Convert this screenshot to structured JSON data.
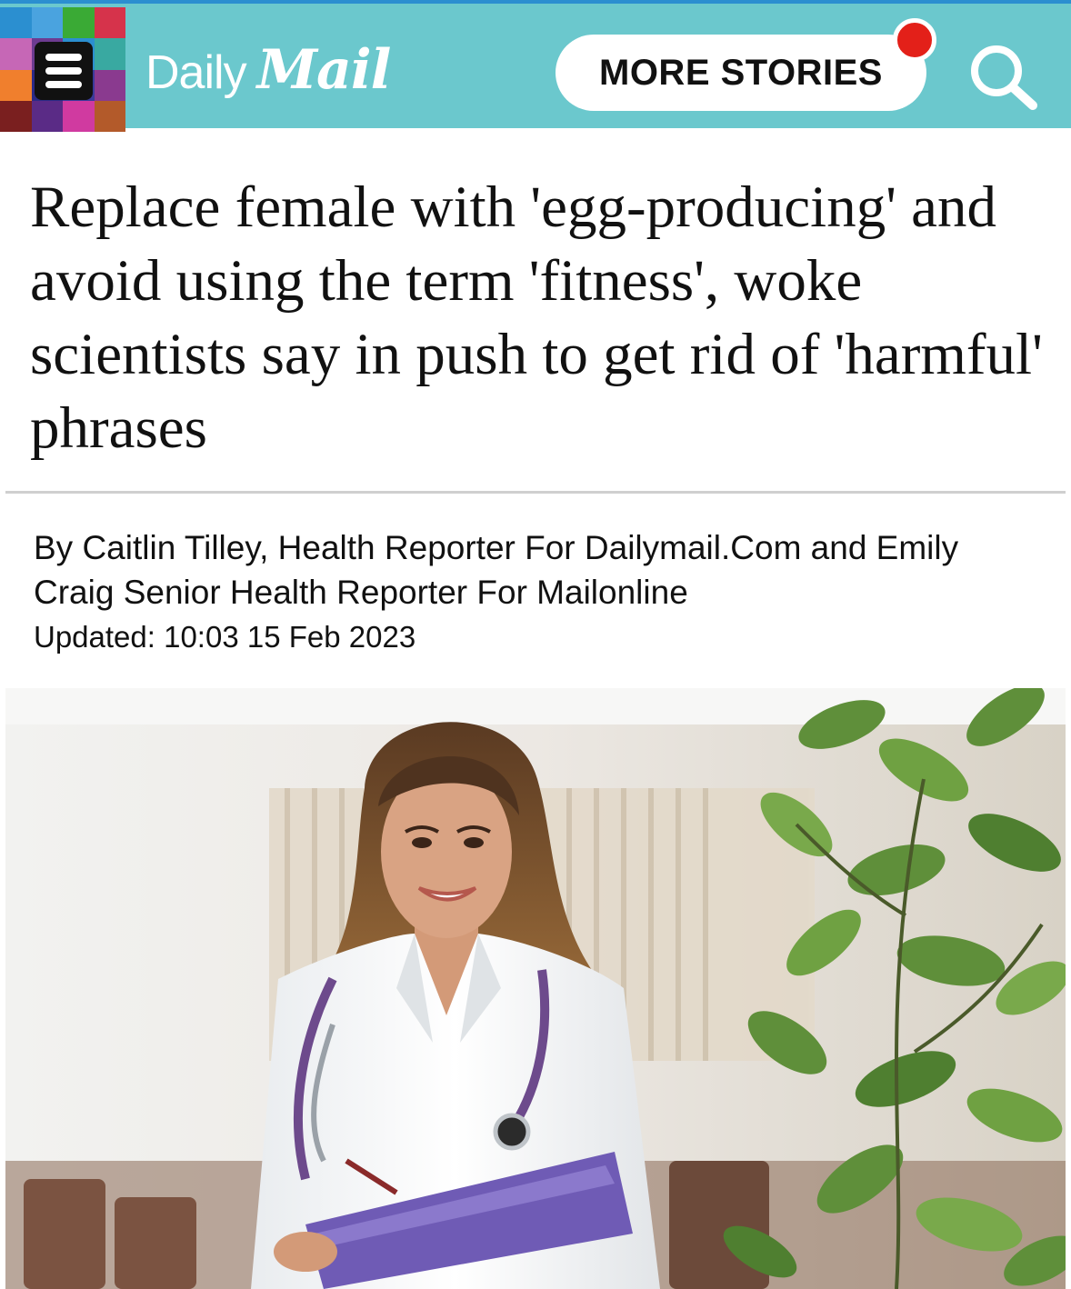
{
  "header": {
    "logo_daily": "Daily",
    "logo_mail": "Mail",
    "more_stories_label": "MORE STORIES",
    "colors": {
      "bar": "#6bc8cd",
      "notification": "#e32019"
    },
    "mosaic_colors": [
      "#2b8fd0",
      "#4aa3df",
      "#3aaa35",
      "#d6334b",
      "#c667b6",
      "#6d3b91",
      "#2b8fd0",
      "#39a9a1",
      "#f07f2d",
      "#2c2a86",
      "#3a3a9a",
      "#8a3a8f",
      "#7a1f1f",
      "#5a2b86",
      "#d03aa0",
      "#b35a2a"
    ],
    "icons": {
      "menu": "hamburger-icon",
      "search": "search-icon"
    }
  },
  "article": {
    "headline": "Replace female with 'egg-producing' and avoid using the term 'fitness', woke scientists say in push to get rid of 'harmful' phrases",
    "byline": "By Caitlin Tilley, Health Reporter For Dailymail.Com and Emily Craig Senior Health Reporter For Mailonline",
    "updated": "Updated: 10:03 15 Feb 2023"
  }
}
